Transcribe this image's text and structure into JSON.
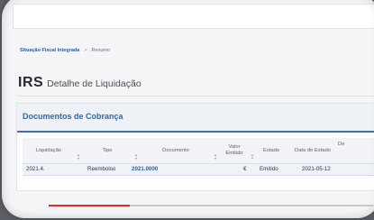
{
  "breadcrumb": {
    "parent": "Situação Fiscal Integrada",
    "separator": ">",
    "current": "Resumo"
  },
  "page": {
    "title": "IRS",
    "subtitle": "Detalhe de Liquidação"
  },
  "panel": {
    "title": "Documentos de Cobrança"
  },
  "table": {
    "columns": [
      "Liquidação",
      "Tipo",
      "Documento",
      "Valor Emitido",
      "Estado",
      "Data de Estado",
      "De"
    ],
    "rows": [
      {
        "liquidacao": "2021.4.",
        "tipo": "Reembolso",
        "documento": "2021.0000",
        "valor": "€",
        "estado": "Emitido",
        "data": "2021-05-12"
      }
    ]
  },
  "video": {
    "progress_fraction": 0.25,
    "progress_color": "#e32b2b"
  },
  "colors": {
    "accent": "#2f67ad",
    "link": "#2b5f97"
  }
}
